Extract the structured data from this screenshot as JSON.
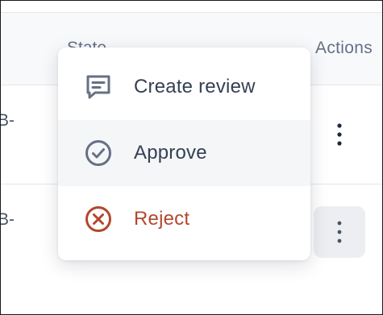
{
  "table": {
    "columns": {
      "state": "State",
      "actions": "Actions"
    },
    "rows": [
      {
        "text": "B-"
      },
      {
        "text": "B-"
      }
    ]
  },
  "menu": {
    "items": [
      {
        "label": "Create review",
        "icon": "review-icon"
      },
      {
        "label": "Approve",
        "icon": "check-circle-icon"
      },
      {
        "label": "Reject",
        "icon": "x-circle-icon"
      }
    ]
  },
  "colors": {
    "reject": "#b4472e",
    "text": "#344054",
    "muted": "#667085",
    "hover": "#f5f6f8"
  }
}
